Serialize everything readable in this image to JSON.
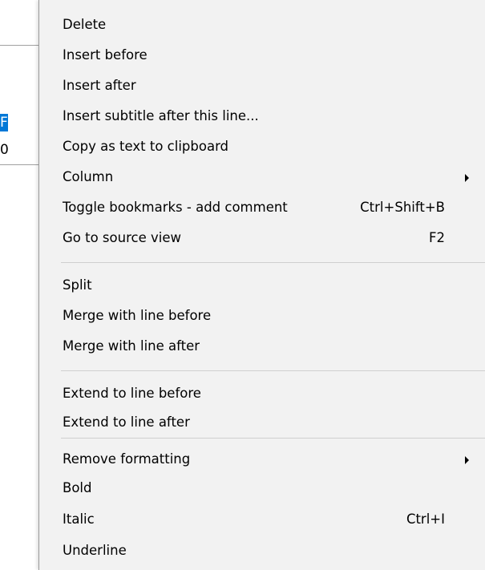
{
  "background": {
    "selected_cell_text": "F",
    "normal_cell_text": "0"
  },
  "menu": {
    "items": [
      {
        "label": "Delete"
      },
      {
        "label": "Insert before"
      },
      {
        "label": "Insert after"
      },
      {
        "label": "Insert subtitle after this line..."
      },
      {
        "label": "Copy as text to clipboard"
      },
      {
        "label": "Column",
        "submenu": true
      },
      {
        "label": "Toggle bookmarks - add comment",
        "shortcut": "Ctrl+Shift+B"
      },
      {
        "label": "Go to source view",
        "shortcut": "F2"
      },
      {
        "label": "Split"
      },
      {
        "label": "Merge with line before"
      },
      {
        "label": "Merge with line after"
      },
      {
        "label": "Extend to line before"
      },
      {
        "label": "Extend to line after"
      },
      {
        "label": "Remove formatting",
        "submenu": true
      },
      {
        "label": "Bold"
      },
      {
        "label": "Italic",
        "shortcut": "Ctrl+I"
      },
      {
        "label": "Underline"
      }
    ]
  },
  "colors": {
    "menu_background": "#f2f2f2",
    "selection": "#0078d7",
    "separator": "#cfcfcf"
  }
}
